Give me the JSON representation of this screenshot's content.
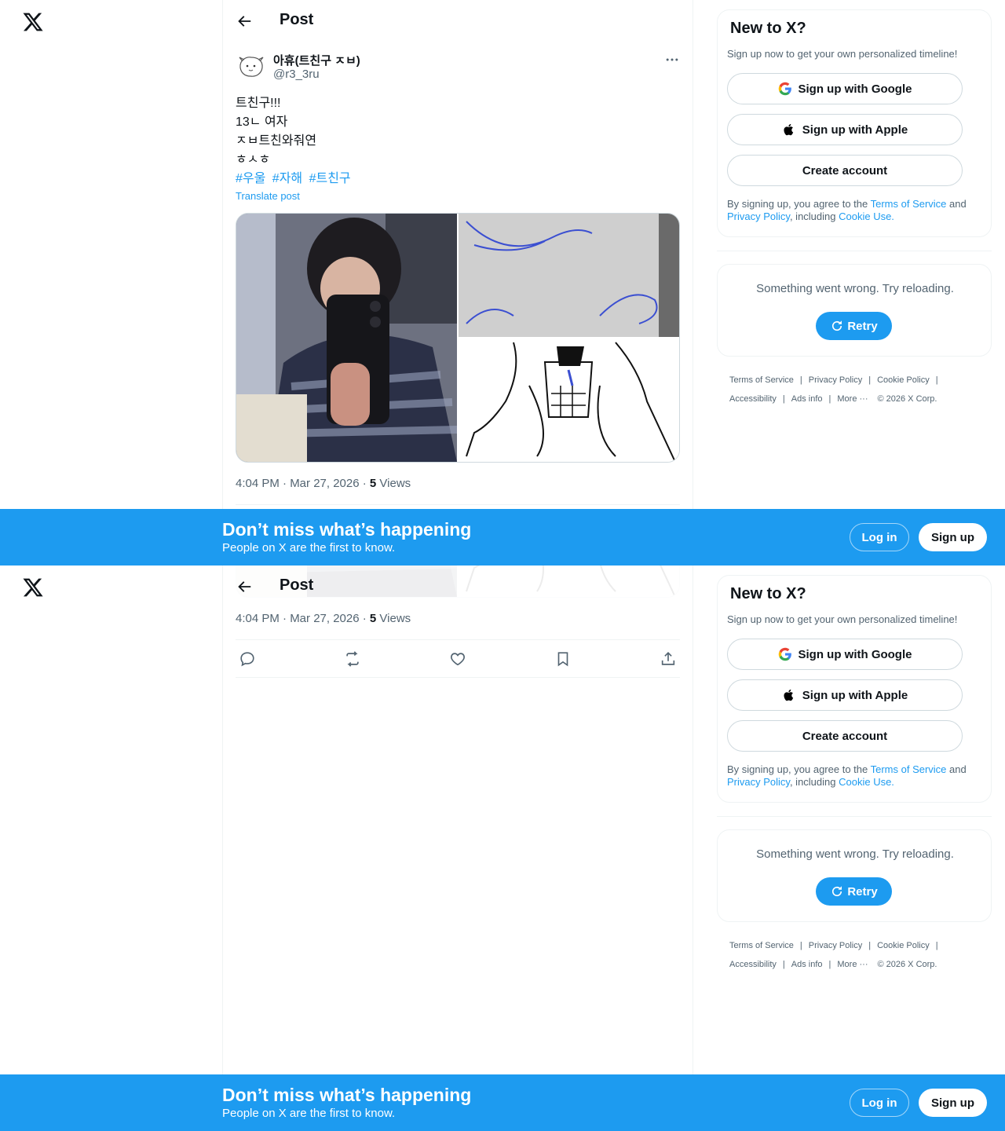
{
  "topbar": {
    "title": "Post"
  },
  "post": {
    "display_name": "아휴(트친구 ㅈㅂ)",
    "handle": "@r3_3ru",
    "text_lines": [
      "트친구!!!",
      "13ㄴ 여자",
      "ㅈㅂ트친와줘연",
      "ㅎㅅㅎ"
    ],
    "hashtags": [
      "#우울",
      "#자해",
      "#트친구"
    ],
    "translate_label": "Translate post",
    "time": "4:04 PM · Mar 27, 2026 · ",
    "views_count": "5",
    "views_label": " Views"
  },
  "actions": {
    "icons": [
      "reply-icon",
      "repost-icon",
      "like-icon",
      "bookmark-icon",
      "share-icon"
    ]
  },
  "sidebar": {
    "signup_card": {
      "title": "New to X?",
      "subtitle": "Sign up now to get your own personalized timeline!",
      "google_label": "Sign up with Google",
      "apple_label": "Sign up with Apple",
      "create_label": "Create account",
      "legal_prefix": "By signing up, you agree to the ",
      "tos": "Terms of Service",
      "and": " and ",
      "privacy": "Privacy Policy",
      "including": ", including ",
      "cookie": "Cookie Use."
    },
    "error_card": {
      "message": "Something went wrong. Try reloading.",
      "retry_label": "Retry"
    },
    "footer": {
      "links": [
        "Terms of Service",
        "Privacy Policy",
        "Cookie Policy",
        "Accessibility",
        "Ads info",
        "More ···"
      ],
      "copyright": "© 2026 X Corp."
    }
  },
  "banner": {
    "title": "Don’t miss what’s happening",
    "subtitle": "People on X are the first to know.",
    "login_label": "Log in",
    "signup_label": "Sign up"
  },
  "colors": {
    "accent": "#1d9bf0",
    "text": "#0f1419",
    "muted": "#536471",
    "border": "#eff3f4"
  }
}
